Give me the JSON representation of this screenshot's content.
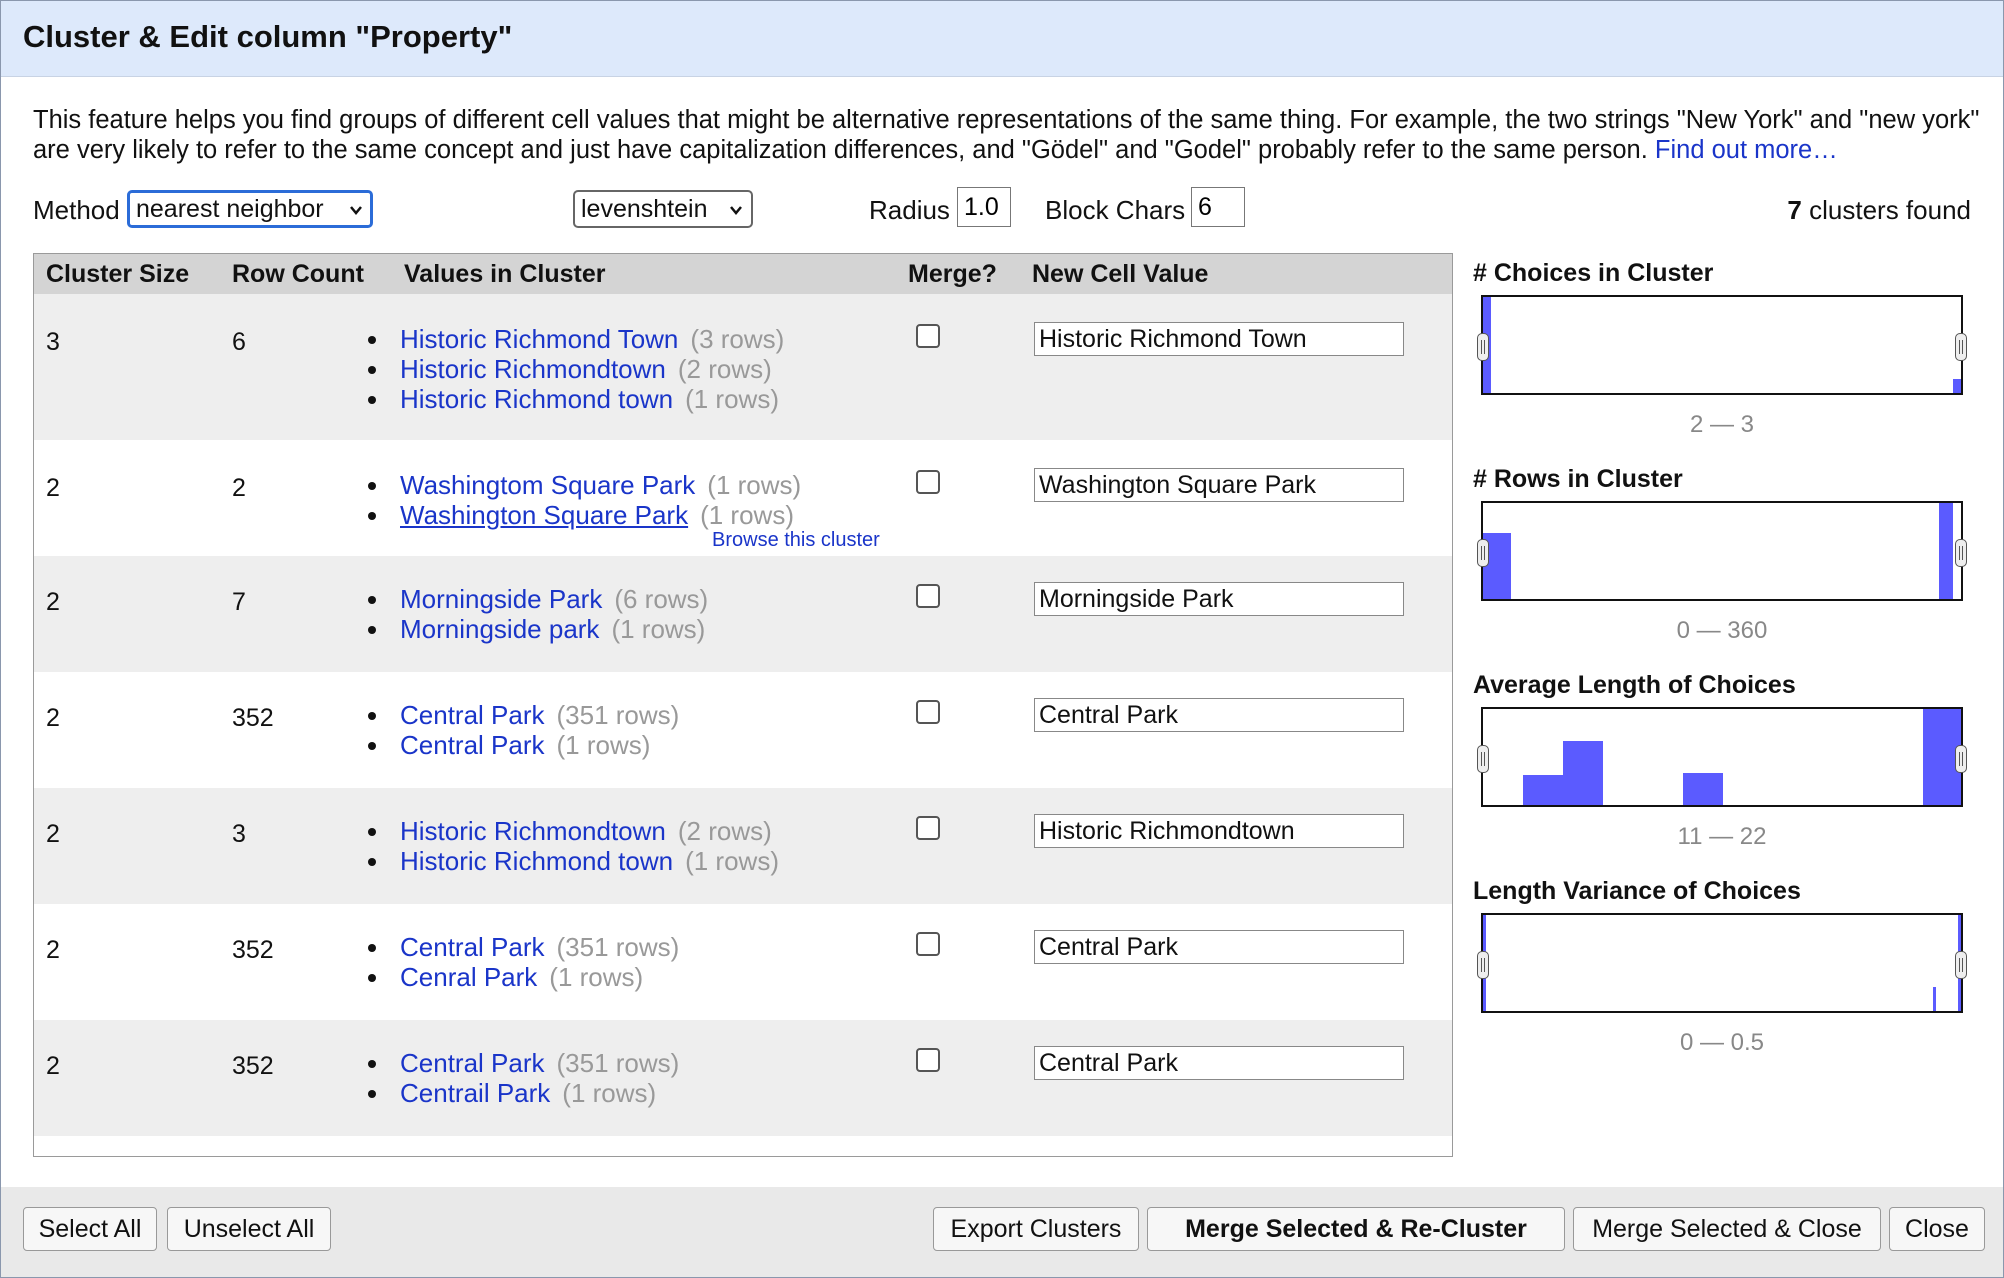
{
  "dialog": {
    "title": "Cluster & Edit column \"Property\"",
    "description": "This feature helps you find groups of different cell values that might be alternative representations of the same thing. For example, the two strings \"New York\" and \"new york\" are very likely to refer to the same concept and just have capitalization differences, and \"Gödel\" and \"Godel\" probably refer to the same person.",
    "find_out_more": "Find out more…"
  },
  "controls": {
    "method_label": "Method",
    "method_value": "nearest neighbor",
    "distance_value": "levenshtein",
    "radius_label": "Radius",
    "radius_value": "1.0",
    "block_chars_label": "Block Chars",
    "block_chars_value": "6",
    "clusters_found_count": "7",
    "clusters_found_text": "clusters found"
  },
  "table": {
    "headers": {
      "cluster_size": "Cluster Size",
      "row_count": "Row Count",
      "values": "Values in Cluster",
      "merge": "Merge?",
      "new_value": "New Cell Value"
    },
    "browse_text": "Browse this cluster",
    "rows": [
      {
        "size": "3",
        "count": "6",
        "new_value": "Historic Richmond Town",
        "values": [
          {
            "text": "Historic Richmond Town",
            "count": "(3 rows)"
          },
          {
            "text": "Historic Richmondtown",
            "count": "(2 rows)"
          },
          {
            "text": "Historic Richmond town",
            "count": "(1 rows)"
          }
        ]
      },
      {
        "size": "2",
        "count": "2",
        "new_value": "Washington Square Park",
        "values": [
          {
            "text": "Washingtom Square Park",
            "count": "(1 rows)"
          },
          {
            "text": "Washington Square Park",
            "count": "(1 rows)"
          }
        ]
      },
      {
        "size": "2",
        "count": "7",
        "new_value": "Morningside Park",
        "values": [
          {
            "text": "Morningside Park",
            "count": "(6 rows)"
          },
          {
            "text": "Morningside park",
            "count": "(1 rows)"
          }
        ]
      },
      {
        "size": "2",
        "count": "352",
        "new_value": "Central Park",
        "values": [
          {
            "text": "Central Park",
            "count": "(351 rows)"
          },
          {
            "text": "Central Park",
            "count": "(1 rows)"
          }
        ]
      },
      {
        "size": "2",
        "count": "3",
        "new_value": "Historic Richmondtown",
        "values": [
          {
            "text": "Historic Richmondtown",
            "count": "(2 rows)"
          },
          {
            "text": "Historic Richmond town",
            "count": "(1 rows)"
          }
        ]
      },
      {
        "size": "2",
        "count": "352",
        "new_value": "Central Park",
        "values": [
          {
            "text": "Central Park",
            "count": "(351 rows)"
          },
          {
            "text": "Cenral Park",
            "count": "(1 rows)"
          }
        ]
      },
      {
        "size": "2",
        "count": "352",
        "new_value": "Central Park",
        "values": [
          {
            "text": "Central Park",
            "count": "(351 rows)"
          },
          {
            "text": "Centrail Park",
            "count": "(1 rows)"
          }
        ]
      }
    ]
  },
  "facets": [
    {
      "title": "# Choices in Cluster",
      "range": "2 — 3"
    },
    {
      "title": "# Rows in Cluster",
      "range": "0 — 360"
    },
    {
      "title": "Average Length of Choices",
      "range": "11 — 22"
    },
    {
      "title": "Length Variance of Choices",
      "range": "0 — 0.5"
    }
  ],
  "footer": {
    "select_all": "Select All",
    "unselect_all": "Unselect All",
    "export": "Export Clusters",
    "merge_recluster": "Merge Selected & Re-Cluster",
    "merge_close": "Merge Selected & Close",
    "close": "Close"
  },
  "colors": {
    "accent": "#1a35c9",
    "histogram_bar": "#5b5bff",
    "title_bg": "#dde9fb"
  }
}
